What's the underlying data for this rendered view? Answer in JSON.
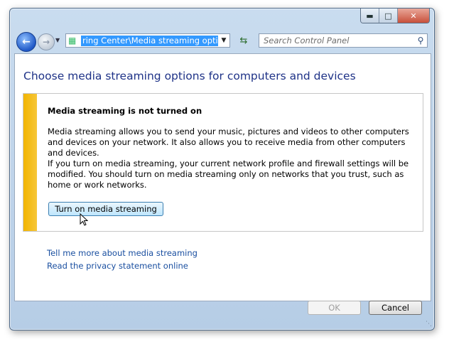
{
  "window": {
    "minimize_icon": "minimize-icon",
    "maximize_icon": "maximize-icon",
    "close_icon": "close-icon"
  },
  "nav": {
    "back_icon": "back-arrow-icon",
    "forward_icon": "forward-arrow-icon"
  },
  "address_bar": {
    "value": "ring Center\\Media streaming options",
    "icon": "control-panel-icon"
  },
  "search": {
    "placeholder": "Search Control Panel",
    "icon": "search-icon"
  },
  "page": {
    "title": "Choose media streaming options for computers and devices",
    "panel": {
      "heading": "Media streaming is not turned on",
      "paragraph1": "Media streaming allows you to send your music, pictures and videos to other computers and devices on your network.  It also allows you to receive media from other computers and devices.",
      "paragraph2": "If you turn on media streaming, your current network profile and firewall settings will be modified.  You should turn on media streaming only on networks that you trust, such as home or work networks.",
      "button_label": "Turn on media streaming"
    },
    "links": [
      "Tell me more about media streaming",
      "Read the privacy statement online"
    ]
  },
  "footer": {
    "ok_label": "OK",
    "cancel_label": "Cancel"
  },
  "colors": {
    "title": "#1e3287",
    "link": "#1a4fa0",
    "stripe": "#f2b500",
    "selection": "#3399ff"
  }
}
